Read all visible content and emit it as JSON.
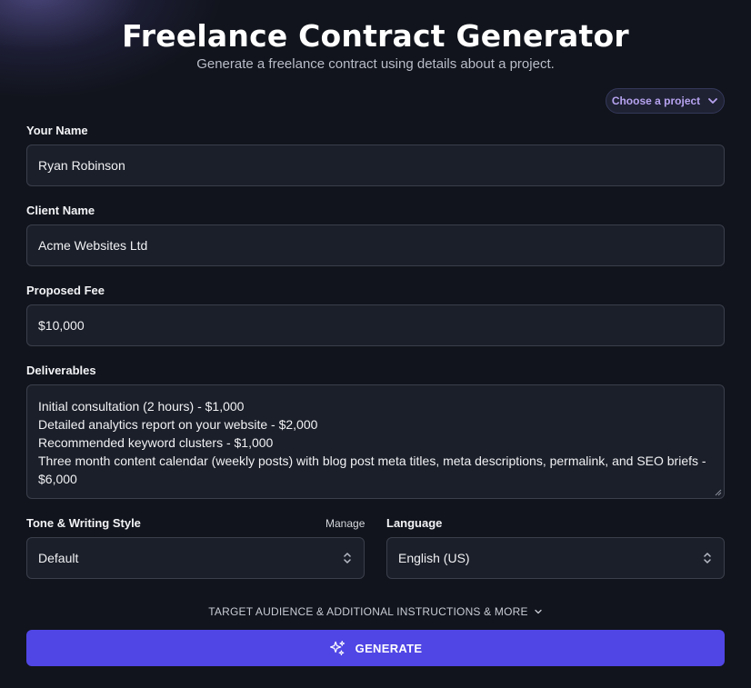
{
  "header": {
    "title": "Freelance Contract Generator",
    "subtitle": "Generate a freelance contract using details about a project."
  },
  "project_selector": {
    "label": "Choose a project",
    "icon": "chevron-down-icon"
  },
  "form": {
    "your_name": {
      "label": "Your Name",
      "value": "Ryan Robinson"
    },
    "client_name": {
      "label": "Client Name",
      "value": "Acme Websites Ltd"
    },
    "proposed_fee": {
      "label": "Proposed Fee",
      "value": "$10,000"
    },
    "deliverables": {
      "label": "Deliverables",
      "lines": [
        "Initial consultation (2 hours) - $1,000",
        "Detailed analytics report on your website - $2,000",
        "Recommended keyword clusters - $1,000",
        "Three month content calendar (weekly posts) with blog post meta titles, meta descriptions, permalink, and SEO briefs - $6,000"
      ]
    },
    "tone": {
      "label": "Tone & Writing Style",
      "manage_label": "Manage",
      "value": "Default"
    },
    "language": {
      "label": "Language",
      "value": "English (US)"
    }
  },
  "more_options": {
    "label": "TARGET AUDIENCE & ADDITIONAL INSTRUCTIONS & MORE",
    "icon": "chevron-down-icon"
  },
  "generate_button": {
    "label": "GENERATE",
    "icon": "sparkles-icon"
  },
  "colors": {
    "background": "#11141c",
    "field_background": "#1b1f29",
    "field_border": "#3a3f4c",
    "accent": "#5046e5",
    "project_text": "#b7a3f0"
  }
}
